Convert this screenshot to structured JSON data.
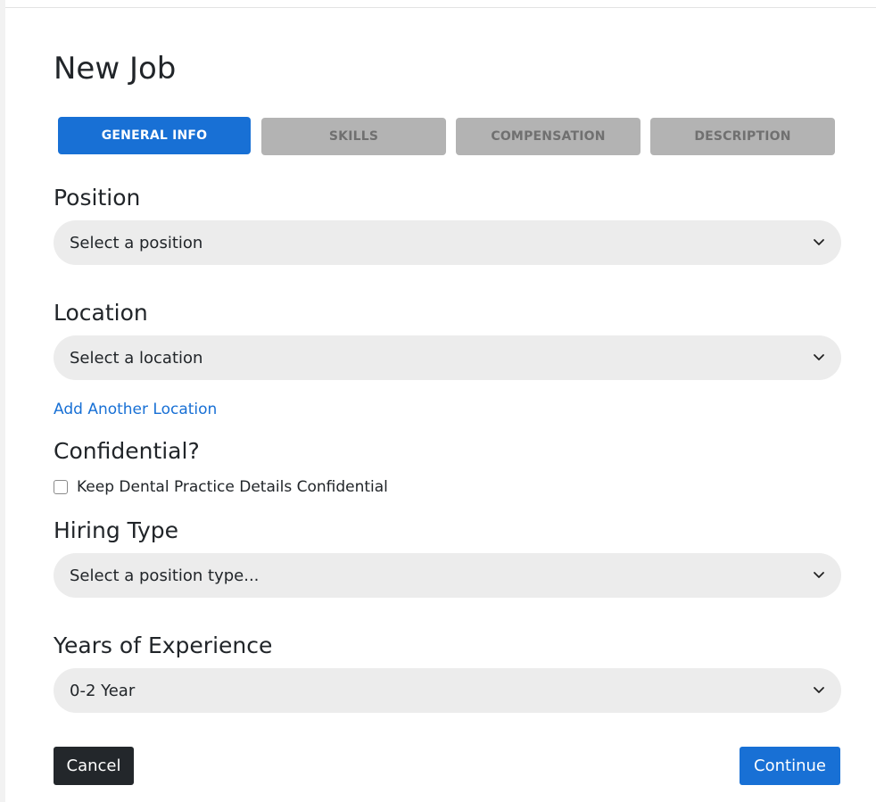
{
  "page": {
    "title": "New Job"
  },
  "tabs": [
    {
      "label": "GENERAL INFO",
      "active": true
    },
    {
      "label": "SKILLS",
      "active": false
    },
    {
      "label": "COMPENSATION",
      "active": false
    },
    {
      "label": "DESCRIPTION",
      "active": false
    }
  ],
  "position": {
    "label": "Position",
    "value": "Select a position"
  },
  "location": {
    "label": "Location",
    "value": "Select a location",
    "add_link": "Add Another Location"
  },
  "confidential": {
    "label": "Confidential?",
    "checkbox_label": "Keep Dental Practice Details Confidential",
    "checked": false
  },
  "hiring_type": {
    "label": "Hiring Type",
    "value": "Select a position type..."
  },
  "experience": {
    "label": "Years of Experience",
    "value": "0-2 Year"
  },
  "actions": {
    "cancel": "Cancel",
    "continue": "Continue"
  },
  "colors": {
    "primary": "#1870d5",
    "tab_inactive": "#b3b3b3",
    "select_bg": "#ececec",
    "dark_button": "#23272b"
  },
  "icons": {
    "select_arrow": "chevron-down-icon"
  }
}
